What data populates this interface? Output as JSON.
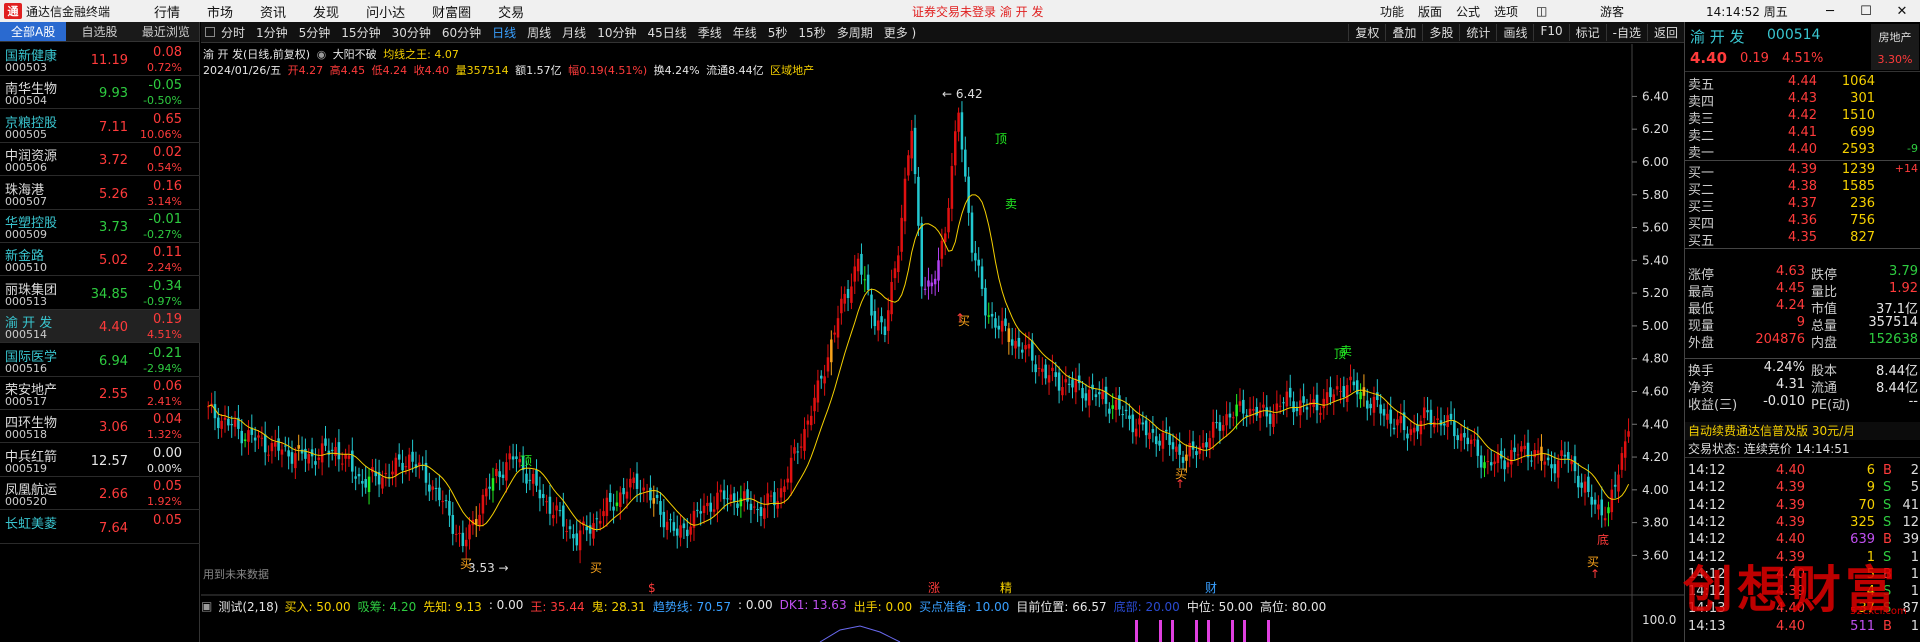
{
  "topbar": {
    "app_title": "通达信金融终端",
    "menu": [
      "行情",
      "市场",
      "资讯",
      "发现",
      "问小达",
      "财富圈",
      "交易"
    ],
    "notice": "证券交易未登录  渝 开 发",
    "right_menu": [
      "功能",
      "版面",
      "公式",
      "选项"
    ],
    "user": "游客",
    "time": "14:14:52 周五"
  },
  "left_tabs": [
    "全部A股",
    "自选股",
    "最近浏览"
  ],
  "stocks": [
    {
      "name": "国新健康",
      "code": "000503",
      "price": "11.19",
      "change": "0.08",
      "pct": "0.72%",
      "dir": "up",
      "name_color": "#39c5cf"
    },
    {
      "name": "南华生物",
      "code": "000504",
      "price": "9.93",
      "change": "-0.05",
      "pct": "-0.50%",
      "dir": "down",
      "name_color": "#dddddd"
    },
    {
      "name": "京粮控股",
      "code": "000505",
      "price": "7.11",
      "change": "0.65",
      "pct": "10.06%",
      "dir": "up",
      "name_color": "#39c5cf"
    },
    {
      "name": "中润资源",
      "code": "000506",
      "price": "3.72",
      "change": "0.02",
      "pct": "0.54%",
      "dir": "up",
      "name_color": "#dddddd"
    },
    {
      "name": "珠海港",
      "code": "000507",
      "price": "5.26",
      "change": "0.16",
      "pct": "3.14%",
      "dir": "up",
      "name_color": "#dddddd"
    },
    {
      "name": "华塑控股",
      "code": "000509",
      "price": "3.73",
      "change": "-0.01",
      "pct": "-0.27%",
      "dir": "down",
      "name_color": "#39c5cf"
    },
    {
      "name": "新金路",
      "code": "000510",
      "price": "5.02",
      "change": "0.11",
      "pct": "2.24%",
      "dir": "up",
      "name_color": "#39c5cf"
    },
    {
      "name": "丽珠集团",
      "code": "000513",
      "price": "34.85",
      "change": "-0.34",
      "pct": "-0.97%",
      "dir": "down",
      "name_color": "#dddddd"
    },
    {
      "name": "渝 开 发",
      "code": "000514",
      "price": "4.40",
      "change": "0.19",
      "pct": "4.51%",
      "dir": "up",
      "name_color": "#39c5cf",
      "selected": true
    },
    {
      "name": "国际医学",
      "code": "000516",
      "price": "6.94",
      "change": "-0.21",
      "pct": "-2.94%",
      "dir": "down",
      "name_color": "#39c5cf"
    },
    {
      "name": "荣安地产",
      "code": "000517",
      "price": "2.55",
      "change": "0.06",
      "pct": "2.41%",
      "dir": "up",
      "name_color": "#dddddd"
    },
    {
      "name": "四环生物",
      "code": "000518",
      "price": "3.06",
      "change": "0.04",
      "pct": "1.32%",
      "dir": "up",
      "name_color": "#dddddd"
    },
    {
      "name": "中兵红箭",
      "code": "000519",
      "price": "12.57",
      "change": "0.00",
      "pct": "0.00%",
      "dir": "flat",
      "name_color": "#dddddd"
    },
    {
      "name": "凤凰航运",
      "code": "000520",
      "price": "2.66",
      "change": "0.05",
      "pct": "1.92%",
      "dir": "up",
      "name_color": "#dddddd"
    },
    {
      "name": "长虹美菱",
      "code": "",
      "price": "7.64",
      "change": "0.05",
      "pct": "",
      "dir": "up",
      "name_color": "#39c5cf"
    }
  ],
  "periods": [
    "分时",
    "1分钟",
    "5分钟",
    "15分钟",
    "30分钟",
    "60分钟",
    "日线",
    "周线",
    "月线",
    "10分钟",
    "45日线",
    "季线",
    "年线",
    "5秒",
    "15秒",
    "多周期",
    "更多 )"
  ],
  "active_period": "日线",
  "chart_tools": [
    "复权",
    "叠加",
    "多股",
    "统计",
    "画线",
    "F10",
    "标记",
    "-自选",
    "返回"
  ],
  "chart_header": {
    "title": "渝 开 发(日线,前复权)",
    "indicator": "大阳不破",
    "ma_label": "均线之王: 4.07",
    "date": "2024/01/26/五",
    "open": "开4.27",
    "high": "高4.45",
    "low": "低4.24",
    "close": "收4.40",
    "vol": "量357514",
    "amount": "额1.57亿",
    "range": "幅0.19(4.51%)",
    "turnover": "换4.24%",
    "float": "流通8.44亿",
    "sector": "区域地产"
  },
  "chart_labels": {
    "high_mark": "6.42",
    "low_mark": "3.53",
    "future_data": "用到未来数据",
    "buy": "买",
    "sell": "卖",
    "top": "顶",
    "bottom": "底",
    "zhang": "涨",
    "jing": "精",
    "cai": "财",
    "dollar": "$"
  },
  "chart_data": {
    "type": "candlestick",
    "ylim": [
      3.45,
      6.5
    ],
    "y_ticks": [
      "6.40",
      "6.20",
      "6.00",
      "5.80",
      "5.60",
      "5.40",
      "5.20",
      "5.00",
      "4.80",
      "4.60",
      "4.40",
      "4.20",
      "4.00",
      "3.80",
      "3.60"
    ],
    "high": 6.42,
    "low": 3.53,
    "ma_last": 4.07
  },
  "indicator_bar": {
    "name": "测试(2,18)",
    "items": [
      {
        "label": "买入: 50.00",
        "color": "#f5d000"
      },
      {
        "label": "吸筹: 4.20",
        "color": "#2ecc40"
      },
      {
        "label": "先知: 9.13",
        "color": "#f5d000"
      },
      {
        "label": ": 0.00",
        "color": "#e6e6e6"
      },
      {
        "label": "王: 35.44",
        "color": "#ff3b3b"
      },
      {
        "label": "鬼: 28.31",
        "color": "#f5d000"
      },
      {
        "label": "趋势线: 70.57",
        "color": "#39a0ff"
      },
      {
        "label": ": 0.00",
        "color": "#e6e6e6"
      },
      {
        "label": "DK1: 13.63",
        "color": "#c050f0"
      },
      {
        "label": "出手: 0.00",
        "color": "#f5d000"
      },
      {
        "label": "买点准备: 10.00",
        "color": "#39a0ff"
      },
      {
        "label": "目前位置: 66.57",
        "color": "#e6e6e6"
      },
      {
        "label": "底部: 20.00",
        "color": "#2a4ad0"
      },
      {
        "label": "中位: 50.00",
        "color": "#e6e6e6"
      },
      {
        "label": "高位: 80.00",
        "color": "#e6e6e6"
      }
    ],
    "y_tick": "100.0"
  },
  "quote": {
    "name": "渝 开 发",
    "code": "000514",
    "price": "4.40",
    "change": "0.19",
    "pct": "4.51%",
    "industry": "房地产",
    "industry_pct": "3.30%",
    "asks": [
      {
        "label": "卖五",
        "price": "4.44",
        "vol": "1064",
        "delta": ""
      },
      {
        "label": "卖四",
        "price": "4.43",
        "vol": "301",
        "delta": ""
      },
      {
        "label": "卖三",
        "price": "4.42",
        "vol": "1510",
        "delta": ""
      },
      {
        "label": "卖二",
        "price": "4.41",
        "vol": "699",
        "delta": ""
      },
      {
        "label": "卖一",
        "price": "4.40",
        "vol": "2593",
        "delta": "-9"
      }
    ],
    "bids": [
      {
        "label": "买一",
        "price": "4.39",
        "vol": "1239",
        "delta": "+14"
      },
      {
        "label": "买二",
        "price": "4.38",
        "vol": "1585",
        "delta": ""
      },
      {
        "label": "买三",
        "price": "4.37",
        "vol": "236",
        "delta": ""
      },
      {
        "label": "买四",
        "price": "4.36",
        "vol": "756",
        "delta": ""
      },
      {
        "label": "买五",
        "price": "4.35",
        "vol": "827",
        "delta": ""
      }
    ],
    "stats": [
      {
        "l1": "涨停",
        "v1": "4.63",
        "c1": "#ff3b3b",
        "l2": "跌停",
        "v2": "3.79",
        "c2": "#2ecc40"
      },
      {
        "l1": "最高",
        "v1": "4.45",
        "c1": "#ff3b3b",
        "l2": "量比",
        "v2": "1.92",
        "c2": "#ff3b3b"
      },
      {
        "l1": "最低",
        "v1": "4.24",
        "c1": "#ff3b3b",
        "l2": "市值",
        "v2": "37.1亿",
        "c2": "#e6e6e6"
      },
      {
        "l1": "现量",
        "v1": "9",
        "c1": "#ff3b3b",
        "l2": "总量",
        "v2": "357514",
        "c2": "#e6e6e6"
      },
      {
        "l1": "外盘",
        "v1": "204876",
        "c1": "#ff3b3b",
        "l2": "内盘",
        "v2": "152638",
        "c2": "#2ecc40"
      }
    ],
    "stats2": [
      {
        "l1": "换手",
        "v1": "4.24%",
        "c1": "#e6e6e6",
        "l2": "股本",
        "v2": "8.44亿",
        "c2": "#e6e6e6"
      },
      {
        "l1": "净资",
        "v1": "4.31",
        "c1": "#e6e6e6",
        "l2": "流通",
        "v2": "8.44亿",
        "c2": "#e6e6e6"
      },
      {
        "l1": "收益(三)",
        "v1": "-0.010",
        "c1": "#e6e6e6",
        "l2": "PE(动)",
        "v2": "--",
        "c2": "#e6e6e6"
      }
    ],
    "ad": "自动续费通达信普及版  30元/月",
    "trade_status": "交易状态: 连续竞价  14:14:51",
    "ticks": [
      {
        "t": "14:12",
        "p": "4.40",
        "v": "6",
        "bs": "B",
        "n": "2",
        "pc": "#ff3b3b",
        "vc": "#f5d000",
        "bc": "#ff3b3b"
      },
      {
        "t": "14:12",
        "p": "4.39",
        "v": "9",
        "bs": "S",
        "n": "5",
        "pc": "#ff3b3b",
        "vc": "#f5d000",
        "bc": "#2ecc40"
      },
      {
        "t": "14:12",
        "p": "4.39",
        "v": "70",
        "bs": "S",
        "n": "41",
        "pc": "#ff3b3b",
        "vc": "#f5d000",
        "bc": "#2ecc40"
      },
      {
        "t": "14:12",
        "p": "4.39",
        "v": "325",
        "bs": "S",
        "n": "12",
        "pc": "#ff3b3b",
        "vc": "#f5d000",
        "bc": "#2ecc40"
      },
      {
        "t": "14:12",
        "p": "4.40",
        "v": "639",
        "bs": "B",
        "n": "39",
        "pc": "#ff3b3b",
        "vc": "#c050f0",
        "bc": "#ff3b3b"
      },
      {
        "t": "14:12",
        "p": "4.39",
        "v": "1",
        "bs": "S",
        "n": "1",
        "pc": "#ff3b3b",
        "vc": "#f5d000",
        "bc": "#2ecc40"
      },
      {
        "t": "14:12",
        "p": "4.40",
        "v": "5",
        "bs": "B",
        "n": "1",
        "pc": "#ff3b3b",
        "vc": "#f5d000",
        "bc": "#ff3b3b"
      },
      {
        "t": "14:12",
        "p": "4.39",
        "v": "4",
        "bs": "S",
        "n": "1",
        "pc": "#ff3b3b",
        "vc": "#f5d000",
        "bc": "#2ecc40"
      },
      {
        "t": "14:13",
        "p": "4.40",
        "v": "37",
        "bs": "S",
        "n": "87",
        "pc": "#ff3b3b",
        "vc": "#f5d000",
        "bc": "#2ecc40"
      },
      {
        "t": "14:13",
        "p": "4.40",
        "v": "511",
        "bs": "B",
        "n": "1",
        "pc": "#ff3b3b",
        "vc": "#c050f0",
        "bc": "#ff3b3b"
      }
    ]
  },
  "watermark": "创想财富",
  "watermark_url": "52cxcf.com"
}
